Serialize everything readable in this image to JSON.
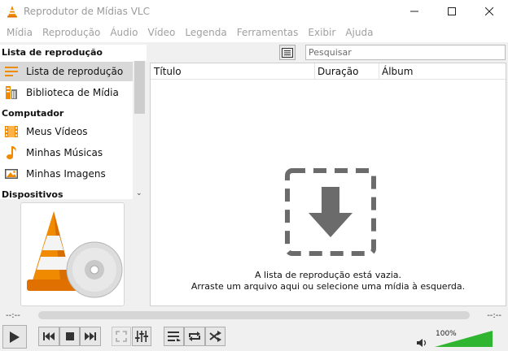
{
  "window": {
    "title": "Reprodutor de Mídias VLC",
    "controls": [
      "minimize",
      "maximize",
      "close"
    ]
  },
  "menu": [
    "Mídia",
    "Reprodução",
    "Áudio",
    "Vídeo",
    "Legenda",
    "Ferramentas",
    "Exibir",
    "Ajuda"
  ],
  "sidebar": {
    "sections": [
      {
        "header": "Lista de reprodução",
        "items": [
          {
            "label": "Lista de reprodução",
            "icon": "playlist-icon",
            "selected": true
          },
          {
            "label": "Biblioteca de Mídia",
            "icon": "media-library-icon",
            "selected": false
          }
        ]
      },
      {
        "header": "Computador",
        "items": [
          {
            "label": "Meus Vídeos",
            "icon": "film-icon",
            "selected": false
          },
          {
            "label": "Minhas Músicas",
            "icon": "music-note-icon",
            "selected": false
          },
          {
            "label": "Minhas Imagens",
            "icon": "picture-icon",
            "selected": false
          }
        ]
      },
      {
        "header": "Dispositivos",
        "items": []
      }
    ]
  },
  "search": {
    "placeholder": "Pesquisar"
  },
  "playlist": {
    "columns": [
      "Título",
      "Duração",
      "Álbum"
    ],
    "empty_line1": "A lista de reprodução está vazia.",
    "empty_line2": "Arraste um arquivo aqui ou selecione uma mídia à esquerda."
  },
  "seek": {
    "elapsed": "--:--",
    "remaining": "--:--"
  },
  "volume": {
    "label": "100%",
    "level": 1.0
  },
  "colors": {
    "accent_orange": "#f08a00",
    "volume_green": "#2fb52f",
    "empty_icon_gray": "#6b6b6b"
  }
}
